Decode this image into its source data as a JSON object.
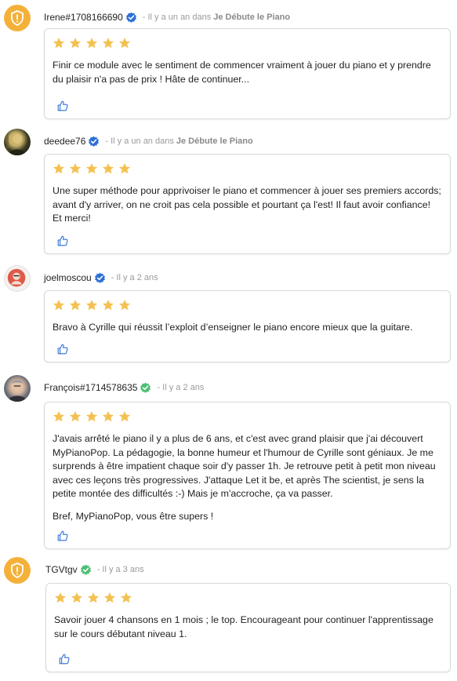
{
  "colors": {
    "star": "#f4c150",
    "verified_blue": "#2d6fd6",
    "verified_green": "#4cbf72",
    "badge": "#f4b13a"
  },
  "icons": {
    "star": "star-icon",
    "like": "thumbs-up-icon",
    "verified": "verified-check-icon",
    "badge": "shield-exclamation-icon"
  },
  "reviews": [
    {
      "username": "Irene#1708166690",
      "meta_prefix": "- Il y a un an dans ",
      "course": "Je Débute le Piano",
      "rating": 5,
      "paragraphs": [
        "Finir ce module avec le sentiment de commencer vraiment à jouer du piano et y prendre du plaisir n'a pas de prix ! Hâte de continuer..."
      ]
    },
    {
      "username": "deedee76",
      "meta_prefix": "- Il y a un an dans ",
      "course": "Je Débute le Piano",
      "rating": 5,
      "paragraphs": [
        "Une super méthode pour apprivoiser le piano et commencer à jouer ses premiers accords; avant d'y arriver, on ne croit pas cela possible et pourtant ça l'est! Il faut avoir confiance! Et merci!"
      ]
    },
    {
      "username": "joelmoscou",
      "meta_prefix": "- Il y a 2 ans",
      "course": "",
      "rating": 5,
      "paragraphs": [
        "Bravo à Cyrille qui réussit l’exploit d’enseigner le piano encore mieux que la guitare."
      ]
    },
    {
      "username": "François#1714578635",
      "meta_prefix": "- Il y a 2 ans",
      "course": "",
      "rating": 5,
      "paragraphs": [
        "J'avais arrêté le piano il y a plus de 6 ans, et c'est avec grand plaisir que j'ai découvert MyPianoPop. La pédagogie, la bonne humeur et l'humour de Cyrille sont géniaux. Je me surprends à être impatient chaque soir d'y passer 1h. Je retrouve petit à petit mon niveau avec ces leçons très progressives. J'attaque Let it be, et après The scientist, je sens la petite montée des difficultés :-) Mais je m'accroche, ça va passer.",
        "Bref, MyPianoPop, vous être supers !"
      ]
    },
    {
      "username": "TGVtgv",
      "meta_prefix": "- Il y a 3 ans",
      "course": "",
      "rating": 5,
      "paragraphs": [
        "Savoir jouer 4 chansons en 1 mois ; le top. Encourageant pour continuer l'apprentissage sur le cours débutant niveau 1."
      ]
    }
  ]
}
